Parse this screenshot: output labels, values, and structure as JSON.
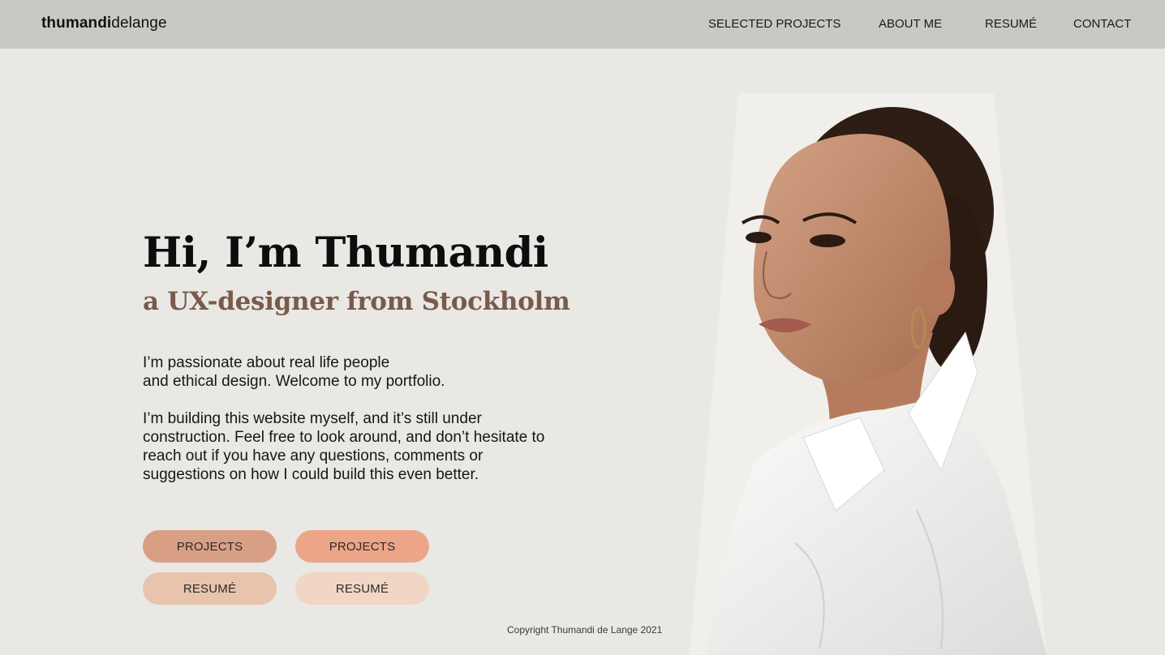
{
  "brand": {
    "first": "thumandi",
    "last": "delange"
  },
  "nav": {
    "items": [
      {
        "label": "SELECTED PROJECTS"
      },
      {
        "label": "ABOUT ME"
      },
      {
        "label": "RESUMÉ"
      },
      {
        "label": "CONTACT"
      }
    ]
  },
  "hero": {
    "title": "Hi, I’m Thumandi",
    "subtitle": "a UX-designer from Stockholm",
    "intro_lines": [
      "I’m passionate about real life people",
      "and ethical design. Welcome to my portfolio."
    ],
    "body_lines": [
      "I’m building this website myself, and it’s still under",
      "construction. Feel free to look around, and don’t hesitate to",
      "reach out if you have any questions, comments or",
      "suggestions on how I could build this even better."
    ]
  },
  "buttons": {
    "projects_1": "PROJECTS",
    "projects_2": "PROJECTS",
    "resume_1": "RESUMÉ",
    "resume_2": "RESUMÉ"
  },
  "colors": {
    "header_bg": "#c9c8c4",
    "page_bg": "#e9e8e5",
    "subtitle": "#7a5a4a",
    "btn_projects_1": "#d89f85",
    "btn_projects_2": "#eca586",
    "btn_resume_1": "#e8c4ac",
    "btn_resume_2": "#f2d6c5"
  },
  "footer": {
    "copyright": "Copyright Thumandi de Lange 2021"
  }
}
